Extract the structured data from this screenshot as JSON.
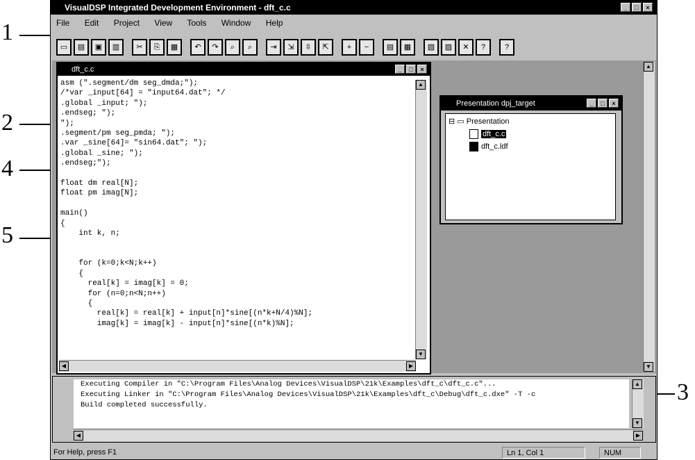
{
  "callouts": [
    "1",
    "2",
    "3",
    "4",
    "5"
  ],
  "window": {
    "title": "VisualDSP Integrated Development Environment - dft_c.c"
  },
  "menu": [
    "File",
    "Edit",
    "Project",
    "View",
    "Tools",
    "Window",
    "Help"
  ],
  "toolbar_icons": [
    "new-file-icon",
    "open-icon",
    "save-icon",
    "save-all-icon",
    "cut-icon",
    "copy-icon",
    "paste-icon",
    "undo-icon",
    "redo-icon",
    "find-icon",
    "find-next-icon",
    "run-icon",
    "step-into-icon",
    "step-over-icon",
    "step-out-icon",
    "breakpoint-icon",
    "remove-breakpoint-icon",
    "build-icon",
    "rebuild-icon",
    "compile-icon",
    "debug-icon",
    "halt-icon",
    "help-icon",
    "context-help-icon"
  ],
  "editor": {
    "title": "dft_c.c",
    "code_lines": [
      "asm (\".segment/dm seg_dmda;\");",
      "/*var _input[64] = \"input64.dat\"; */",
      ".global _input; \");",
      ".endseg; \");",
      "\");",
      ".segment/pm seg_pmda; \");",
      ".var _sine[64]= \"sin64.dat\"; \");",
      ".global _sine; \");",
      ".endseg;\");",
      "",
      "float dm real[N];",
      "float pm imag[N];",
      "",
      "main()",
      "{",
      "    int k, n;",
      "",
      "",
      "    for (k=0;k<N;k++)",
      "    {",
      "      real[k] = imag[k] = 0;",
      "      for (n=0;n<N;n++)",
      "      {",
      "        real[k] = real[k] + input[n]*sine[(n*k+N/4)%N];",
      "        imag[k] = imag[k] - input[n]*sine[(n*k)%N];"
    ]
  },
  "project": {
    "title": "Presentation dpj_target",
    "root": "Presentation",
    "files": [
      "dft_c.c",
      "dft_c.ldf"
    ]
  },
  "output": {
    "lines": [
      "Executing Compiler in \"C:\\Program Files\\Analog Devices\\VisualDSP\\21k\\Examples\\dft_c\\dft_c.c\"...",
      "Executing Linker in \"C:\\Program Files\\Analog Devices\\VisualDSP\\21k\\Examples\\dft_c\\Debug\\dft_c.dxe\" -T -c",
      "Build completed successfully."
    ]
  },
  "status": {
    "left": "For Help, press F1",
    "position": "Ln 1, Col 1",
    "mode": "NUM"
  }
}
